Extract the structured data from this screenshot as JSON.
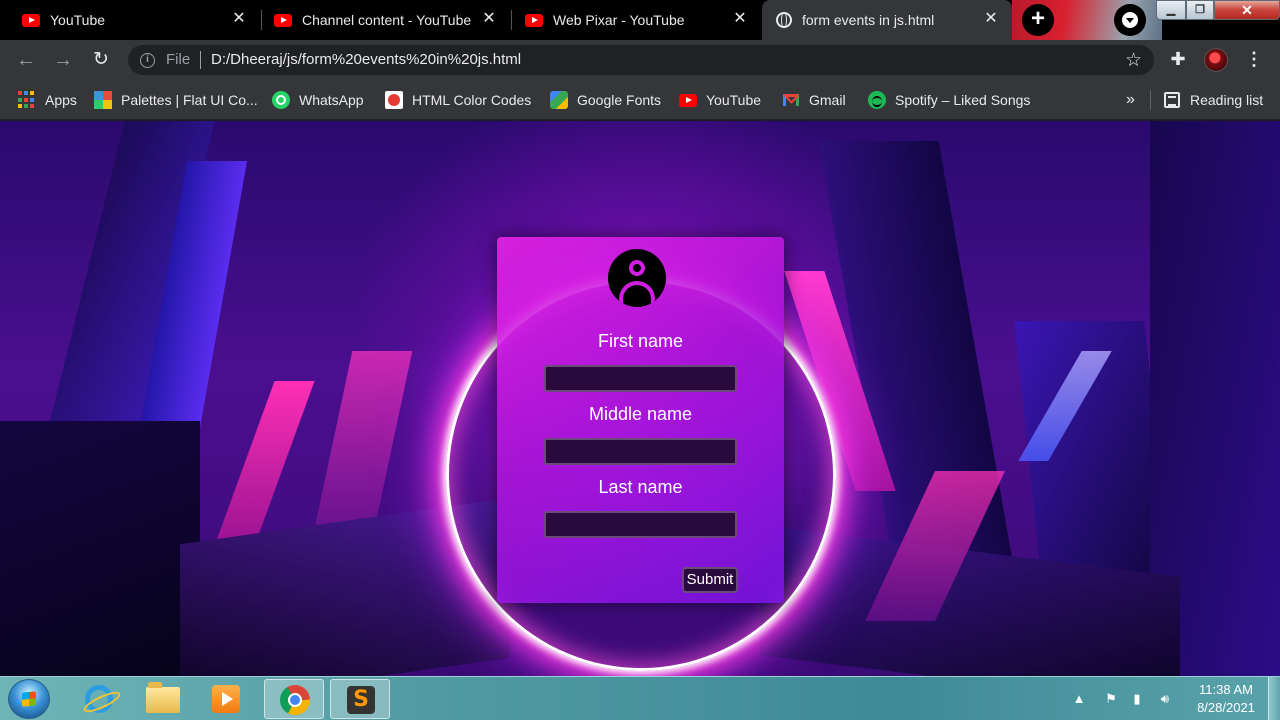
{
  "browser": {
    "tabs": [
      {
        "title": "YouTube",
        "icon": "youtube-icon",
        "active": false
      },
      {
        "title": "Channel content - YouTube",
        "icon": "youtube-icon",
        "active": false
      },
      {
        "title": "Web Pixar - YouTube",
        "icon": "youtube-icon",
        "active": false
      },
      {
        "title": "form events in js.html",
        "icon": "globe-icon",
        "active": true
      }
    ],
    "close_glyph": "✕",
    "new_tab_glyph": "+",
    "address": {
      "scheme_label": "File",
      "url": "D:/Dheeraj/js/form%20events%20in%20js.html"
    },
    "bookmarks": [
      {
        "label": "Apps",
        "icon": "apps-grid-icon"
      },
      {
        "label": "Palettes | Flat UI Co...",
        "icon": "palette-icon"
      },
      {
        "label": "WhatsApp",
        "icon": "whatsapp-icon"
      },
      {
        "label": "HTML Color Codes",
        "icon": "html-color-codes-icon"
      },
      {
        "label": "Google Fonts",
        "icon": "google-fonts-icon"
      },
      {
        "label": "YouTube",
        "icon": "youtube-icon"
      },
      {
        "label": "Gmail",
        "icon": "gmail-icon"
      },
      {
        "label": "Spotify – Liked Songs",
        "icon": "spotify-icon"
      }
    ],
    "bookmarks_more": "»",
    "reading_list": "Reading list"
  },
  "form": {
    "fields": [
      {
        "label": "First name",
        "value": ""
      },
      {
        "label": "Middle name",
        "value": ""
      },
      {
        "label": "Last name",
        "value": ""
      }
    ],
    "submit_label": "Submit"
  },
  "taskbar": {
    "apps": [
      "internet-explorer-icon",
      "file-explorer-icon",
      "media-player-icon",
      "chrome-icon",
      "sublime-text-icon"
    ],
    "active_app": "chrome-icon",
    "clock": {
      "time": "11:38 AM",
      "date": "8/28/2021"
    }
  },
  "colors": {
    "accent_pink": "#e923e6",
    "card_purple": "#7814e1",
    "input_bg": "#2a0a3d",
    "tab_active": "#35363a"
  }
}
